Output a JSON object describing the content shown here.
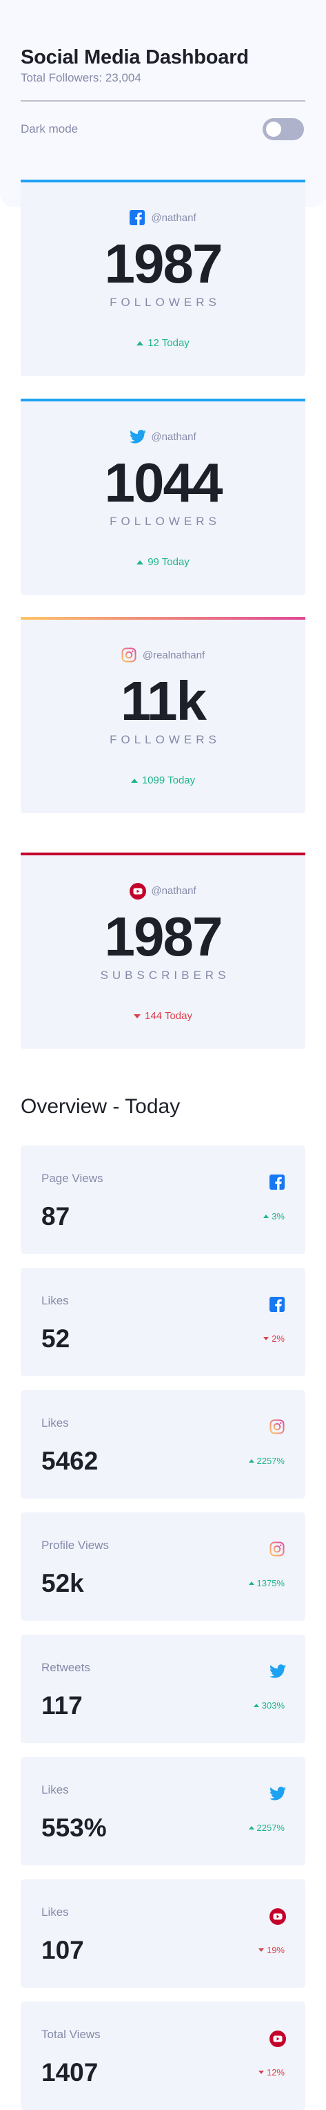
{
  "header": {
    "title": "Social Media Dashboard",
    "subtitle": "Total Followers: 23,004",
    "dark_mode_label": "Dark mode"
  },
  "cards": [
    {
      "platform": "facebook",
      "icon": "facebook-icon",
      "handle": "@nathanf",
      "count": "1987",
      "label": "FOLLOWERS",
      "today": "12 Today",
      "trend": "up",
      "accent": "#1da1f2"
    },
    {
      "platform": "twitter",
      "icon": "twitter-icon",
      "handle": "@nathanf",
      "count": "1044",
      "label": "FOLLOWERS",
      "today": "99 Today",
      "trend": "up",
      "accent": "#1da1f2"
    },
    {
      "platform": "instagram",
      "icon": "instagram-icon",
      "handle": "@realnathanf",
      "count": "11k",
      "label": "FOLLOWERS",
      "today": "1099 Today",
      "trend": "up",
      "accent": "#df4996"
    },
    {
      "platform": "youtube",
      "icon": "youtube-icon",
      "handle": "@nathanf",
      "count": "1987",
      "label": "SUBSCRIBERS",
      "today": "144 Today",
      "trend": "down",
      "accent": "#c4032b"
    }
  ],
  "overview": {
    "title": "Overview - Today",
    "items": [
      {
        "label": "Page Views",
        "value": "87",
        "icon": "facebook-icon",
        "change": "3%",
        "trend": "up"
      },
      {
        "label": "Likes",
        "value": "52",
        "icon": "facebook-icon",
        "change": "2%",
        "trend": "down"
      },
      {
        "label": "Likes",
        "value": "5462",
        "icon": "instagram-icon",
        "change": "2257%",
        "trend": "up"
      },
      {
        "label": "Profile Views",
        "value": "52k",
        "icon": "instagram-icon",
        "change": "1375%",
        "trend": "up"
      },
      {
        "label": "Retweets",
        "value": "117",
        "icon": "twitter-icon",
        "change": "303%",
        "trend": "up"
      },
      {
        "label": "Likes",
        "value": "553%",
        "icon": "twitter-icon",
        "change": "2257%",
        "trend": "up"
      },
      {
        "label": "Likes",
        "value": "107",
        "icon": "youtube-icon",
        "change": "19%",
        "trend": "down"
      },
      {
        "label": "Total Views",
        "value": "1407",
        "icon": "youtube-icon",
        "change": "12%",
        "trend": "down"
      }
    ]
  },
  "colors": {
    "up": "#1eb589",
    "down": "#dc414c",
    "facebook": "#1778f2",
    "twitter": "#1da1f2",
    "youtube": "#c4032b",
    "card_bg": "#f1f4fb"
  }
}
